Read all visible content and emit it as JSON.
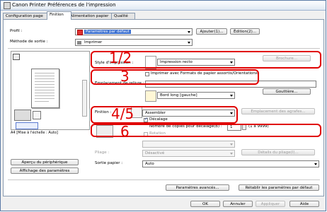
{
  "window": {
    "title": "Canon Printer Préférences de l'impression"
  },
  "tabs": [
    {
      "label": "Configuration page"
    },
    {
      "label": "Finition"
    },
    {
      "label": "Alimentation papier"
    },
    {
      "label": "Qualité"
    }
  ],
  "profile": {
    "label": "Profil :",
    "value": "Paramètres par défaut",
    "add_button": "Ajouter(1)...",
    "edit_button": "Édition(2)..."
  },
  "output_method": {
    "label": "Méthode de sortie :",
    "value": "Imprimer"
  },
  "print_style": {
    "label": "Style d'impression :",
    "value": "Impression recto",
    "brochure_button": "Brochure..."
  },
  "mixed_paper": {
    "label": "Imprimer avec Formats de papier assortis/Orientations"
  },
  "binding": {
    "label": "Emplacement de reliure :",
    "value": "Bord long [gauche]",
    "gutter_button": "Gouttière..."
  },
  "finishing": {
    "label": "Finition :",
    "value": "Assembler",
    "staple_button": "Emplacement des agrafes...",
    "offset_label": "Décalage"
  },
  "copies": {
    "label": "Nombre de copies pour décalage(B) :",
    "value": "1",
    "range": "(1 à 9999)",
    "rotation_label": "Rotation"
  },
  "fold": {
    "label": "Pliage :",
    "value": "Désactivé",
    "details_button": "Détails du pliage(I)..."
  },
  "output_paper": {
    "label": "Sortie papier :",
    "value": "Auto"
  },
  "preview": {
    "caption": "A4 [Mise à l'échelle : Auto]"
  },
  "left_buttons": {
    "device_preview": "Aperçu du périphérique",
    "show_settings": "Affichage des paramètres"
  },
  "bottom": {
    "advanced_button": "Paramètres avancés...",
    "restore_button": "Rétablir les paramètres par défaut"
  },
  "footer": {
    "ok": "OK",
    "cancel": "Annuler",
    "apply": "Appliquer",
    "help": "Aide"
  },
  "annotations": {
    "n12": "1/2",
    "n3": "3",
    "n45": "4/5",
    "n6": "6"
  }
}
